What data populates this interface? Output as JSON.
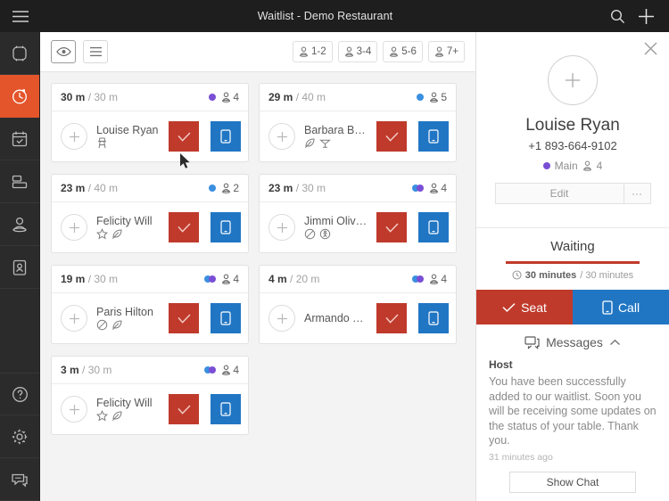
{
  "topbar": {
    "menu_icon": "hamburger-icon",
    "title": "Waitlist - Demo Restaurant",
    "search_icon": "search-icon",
    "add_icon": "plus-icon"
  },
  "sidebar": {
    "items": [
      {
        "icon": "table-icon",
        "name": "tables",
        "active": false
      },
      {
        "icon": "clock-icon",
        "name": "waitlist",
        "active": true
      },
      {
        "icon": "calendar-check-icon",
        "name": "reservations",
        "active": false
      },
      {
        "icon": "layout-icon",
        "name": "floorplan",
        "active": false
      },
      {
        "icon": "host-icon",
        "name": "host",
        "active": false
      },
      {
        "icon": "contacts-icon",
        "name": "guestbook",
        "active": false
      }
    ],
    "bottom_items": [
      {
        "icon": "help-icon",
        "name": "help"
      },
      {
        "icon": "gear-icon",
        "name": "settings"
      },
      {
        "icon": "chat-icon",
        "name": "chat"
      }
    ]
  },
  "toolbar": {
    "view_icon": "eye-icon",
    "list_icon": "list-icon",
    "filters": [
      {
        "label": "1-2"
      },
      {
        "label": "3-4"
      },
      {
        "label": "5-6"
      },
      {
        "label": "7+"
      }
    ]
  },
  "cards": [
    {
      "waited": "30 m",
      "quoted": "/ 30 m",
      "dots": [
        "purple"
      ],
      "party": "4",
      "name": "Louise Ryan",
      "tags": [
        "highchair-icon"
      ],
      "seat_icon": "check-icon",
      "call_icon": "phone-icon"
    },
    {
      "waited": "29 m",
      "quoted": "/ 40 m",
      "dots": [
        "blue"
      ],
      "party": "5",
      "name": "Barbara Biebe",
      "tags": [
        "leaf-icon",
        "cocktail-table-icon"
      ],
      "seat_icon": "check-icon",
      "call_icon": "phone-icon"
    },
    {
      "waited": "23 m",
      "quoted": "/ 40 m",
      "dots": [
        "blue"
      ],
      "party": "2",
      "name": "Felicity Will",
      "tags": [
        "star-icon",
        "leaf-icon"
      ],
      "seat_icon": "check-icon",
      "call_icon": "phone-icon"
    },
    {
      "waited": "23 m",
      "quoted": "/ 30 m",
      "dots": [
        "blue",
        "purple"
      ],
      "party": "4",
      "name": "Jimmi Olivier",
      "tags": [
        "no-entry-icon",
        "accessible-icon"
      ],
      "seat_icon": "check-icon",
      "call_icon": "phone-icon"
    },
    {
      "waited": "19 m",
      "quoted": "/ 30 m",
      "dots": [
        "blue",
        "purple"
      ],
      "party": "4",
      "name": "Paris Hilton",
      "tags": [
        "no-entry-icon",
        "leaf-icon"
      ],
      "seat_icon": "check-icon",
      "call_icon": "phone-icon"
    },
    {
      "waited": "4 m",
      "quoted": "/ 20 m",
      "dots": [
        "blue",
        "purple"
      ],
      "party": "4",
      "name": "Armando Tucke",
      "tags": [],
      "seat_icon": "check-icon",
      "call_icon": "phone-icon"
    },
    {
      "waited": "3 m",
      "quoted": "/ 30 m",
      "dots": [
        "blue",
        "purple"
      ],
      "party": "4",
      "name": "Felicity Will",
      "tags": [
        "star-icon",
        "leaf-icon"
      ],
      "seat_icon": "check-icon",
      "call_icon": "phone-icon"
    }
  ],
  "panel": {
    "close_icon": "close-icon",
    "avatar_icon": "plus-icon",
    "name": "Louise Ryan",
    "phone": "+1 893-664-9102",
    "area": "Main",
    "party": "4",
    "edit_label": "Edit",
    "more_label": "···",
    "status_title": "Waiting",
    "status_elapsed": "30 minutes",
    "status_quoted": "/ 30 minutes",
    "seat_label": "Seat",
    "call_label": "Call",
    "messages": {
      "title": "Messages",
      "collapse_icon": "chevron-up-icon",
      "from": "Host",
      "text": "You have been successfully added to our waitlist. Soon you will be receiving some updates on the status of your table. Thank you.",
      "time": "31 minutes ago",
      "show_chat_label": "Show Chat"
    }
  },
  "colors": {
    "accent_orange": "#e4552b",
    "seat_red": "#bf3a2b",
    "call_blue": "#2176c4",
    "dot_blue": "#3a8fe0",
    "dot_purple": "#7a4fd6",
    "topbar_dark": "#1e1e1e",
    "rail_dark": "#2b2b2b"
  }
}
